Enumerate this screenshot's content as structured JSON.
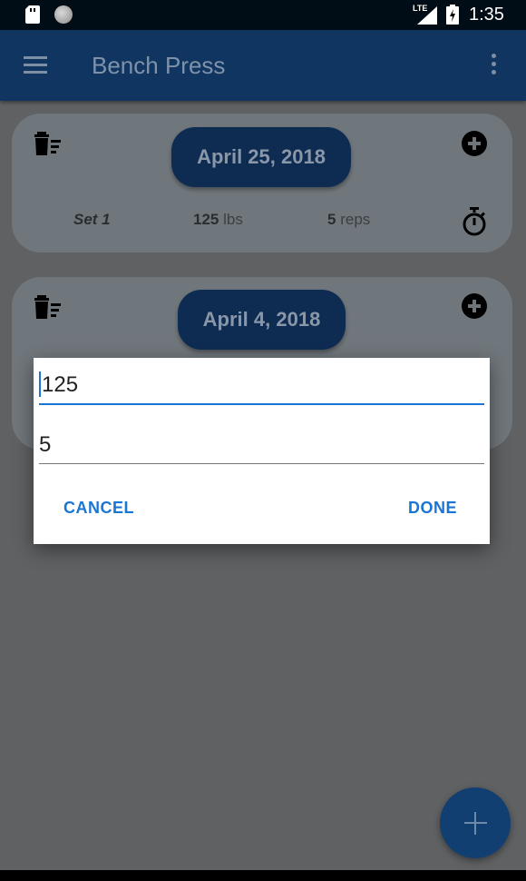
{
  "status_bar": {
    "network": "LTE",
    "time": "1:35"
  },
  "app_bar": {
    "title": "Bench Press"
  },
  "workouts": [
    {
      "date": "April 25, 2018",
      "sets": [
        {
          "label": "Set 1",
          "weight": "125",
          "weight_unit": "lbs",
          "reps": "5",
          "reps_unit": "reps"
        }
      ]
    },
    {
      "date": "April 4, 2018"
    }
  ],
  "dialog": {
    "weight_value": "125",
    "reps_value": "5",
    "cancel_label": "CANCEL",
    "done_label": "DONE"
  },
  "colors": {
    "app_bar": "#0f3560",
    "accent": "#1976d2",
    "scrim_background": "#5f6163"
  }
}
